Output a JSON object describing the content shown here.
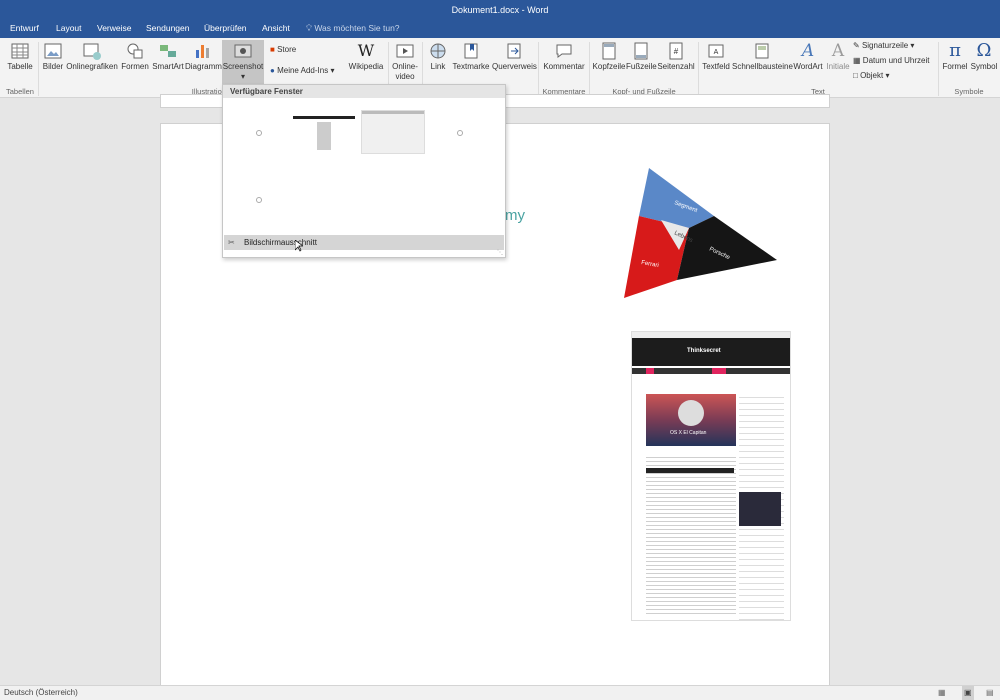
{
  "window": {
    "title": "Dokument1.docx - Word"
  },
  "tabs": [
    "Entwurf",
    "Layout",
    "Verweise",
    "Sendungen",
    "Überprüfen",
    "Ansicht"
  ],
  "tellme": "Was möchten Sie tun?",
  "ribbon": {
    "buttons": [
      "Tabelle",
      "Bilder",
      "Onlinegrafiken",
      "Formen",
      "SmartArt",
      "Diagramm",
      "Screenshot",
      "Wikipedia",
      "Online-video",
      "Link",
      "Textmarke",
      "Querverweis",
      "Kommentar",
      "Kopfzeile",
      "Fußzeile",
      "Seitenzahl",
      "Textfeld",
      "Schnellbausteine",
      "WordArt",
      "Initiale",
      "Formel",
      "Symbol"
    ],
    "small": {
      "store": "Store",
      "addins": "Meine Add-Ins",
      "signatur": "Signaturzeile",
      "datum": "Datum und Uhrzeit",
      "objekt": "Objekt"
    },
    "groups": [
      "Tabellen",
      "Illustrationen",
      "Kommentare",
      "Kopf- und Fußzeile",
      "Text",
      "Symbole"
    ]
  },
  "dropdown": {
    "header": "Verfügbare Fenster",
    "footer": "Bildschirmausschnitt"
  },
  "doc": {
    "partial_text": "my",
    "pyramid": {
      "top": "Segment",
      "center": "Lebens",
      "left": "Ferrari",
      "right": "Porsche"
    },
    "thumb": {
      "brand": "Thinksecret",
      "headline": "OS X El Capitan"
    }
  },
  "status": {
    "language": "Deutsch (Österreich)"
  },
  "colors": {
    "accent": "#2b579a",
    "teal": "#4aa3a2"
  }
}
